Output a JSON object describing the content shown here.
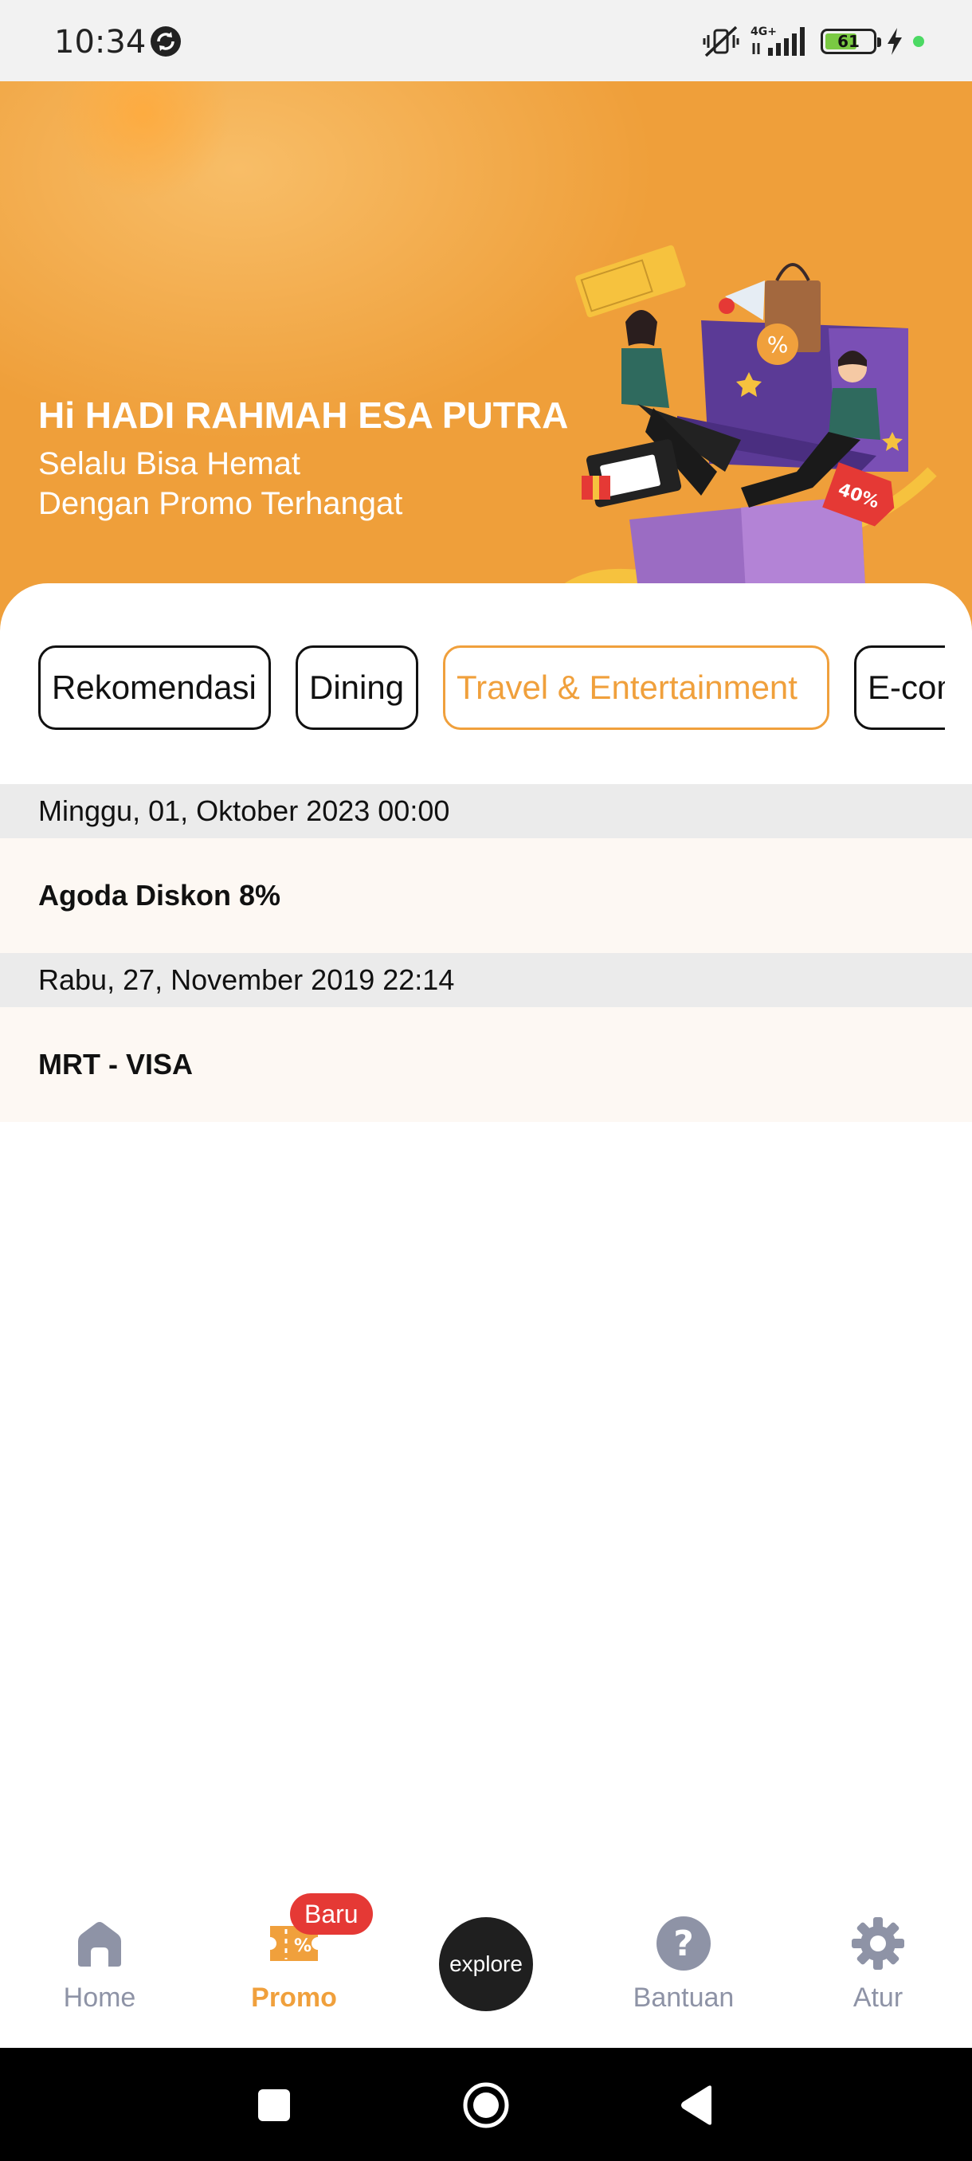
{
  "status_bar": {
    "time": "10:34",
    "network": "4G+",
    "battery": "61",
    "icons": [
      "sync-icon",
      "mute-vibrate-icon",
      "signal-icon",
      "battery-icon",
      "charging-icon",
      "status-dot-icon"
    ]
  },
  "hero": {
    "greeting": "Hi HADI RAHMAH ESA PUTRA",
    "tagline_line1": "Selalu Bisa Hemat",
    "tagline_line2": "Dengan Promo Terhangat",
    "illustration": "gift-box-shopping-icon"
  },
  "categories": [
    {
      "label": "Rekomendasi",
      "active": false
    },
    {
      "label": "Dining",
      "active": false
    },
    {
      "label": "Travel & Entertainment",
      "active": true
    },
    {
      "label": "E-commerce",
      "active": false
    }
  ],
  "promos": [
    {
      "date": "Minggu, 01, Oktober 2023 00:00",
      "title": "Agoda Diskon 8%"
    },
    {
      "date": "Rabu, 27, November 2019 22:14",
      "title": "MRT - VISA"
    }
  ],
  "bottom_nav": {
    "items": [
      {
        "label": "Home",
        "icon": "home-icon"
      },
      {
        "label": "Promo",
        "icon": "promo-ticket-icon",
        "active": true
      },
      {
        "label": "Bantuan",
        "icon": "help-icon"
      },
      {
        "label": "Atur",
        "icon": "settings-gear-icon"
      }
    ],
    "promo_badge": "Baru",
    "explore_label": "explore"
  },
  "colors": {
    "accent": "#f0a03c",
    "hero_bg": "#ef9f3a",
    "badge": "#e53935",
    "date_row_bg": "#ebebeb",
    "promo_row_bg": "#fdf8f3",
    "nav_inactive": "#8e93a6"
  }
}
